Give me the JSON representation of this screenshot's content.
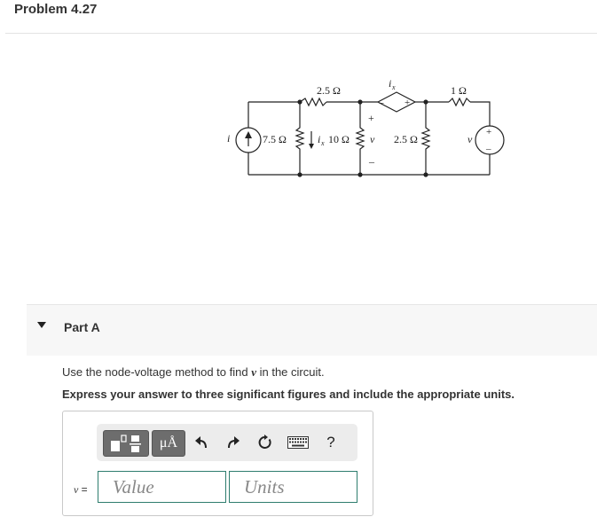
{
  "header": {
    "title": "Problem 4.27"
  },
  "circuit": {
    "labels": {
      "i_source": "i",
      "r_top_left": "2.5 Ω",
      "r_top_right": "1 Ω",
      "ix_top": "i",
      "ix_top_sub": "x",
      "r_75": "7.5 Ω",
      "ix_mid": "i",
      "ix_mid_sub": "x",
      "r_10": "10 Ω",
      "v_mid": "v",
      "plus_mid": "+",
      "minus_mid": "–",
      "r_25": "2.5 Ω",
      "v_right": "v",
      "plus_right": "+",
      "minus_right": "–",
      "dep_minus": "–",
      "dep_plus": "+"
    }
  },
  "part": {
    "label": "Part A"
  },
  "instructions": {
    "line1_prefix": "Use the node-voltage method to find ",
    "line1_var": "v",
    "line1_suffix": " in the circuit.",
    "line2": "Express your answer to three significant figures and include the appropriate units."
  },
  "toolbar": {
    "units_label": "μÅ",
    "help_label": "?"
  },
  "answer": {
    "var": "v",
    "eq": " =",
    "value_placeholder": "Value",
    "units_placeholder": "Units"
  }
}
